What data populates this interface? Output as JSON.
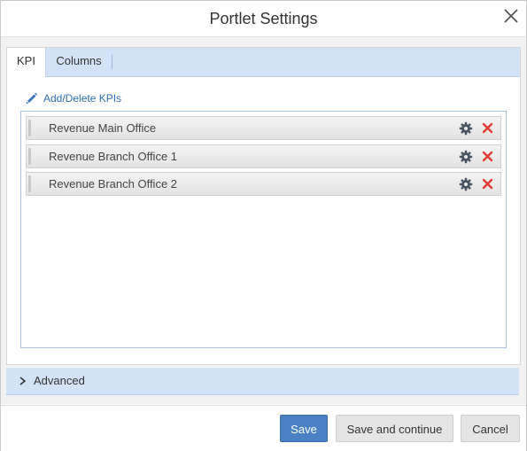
{
  "dialog": {
    "title": "Portlet Settings",
    "close_icon": "close-icon"
  },
  "tabs": [
    {
      "label": "KPI",
      "active": true
    },
    {
      "label": "Columns",
      "active": false
    }
  ],
  "kpi": {
    "add_link_label": "Add/Delete KPIs",
    "add_link_icon": "pencil-icon",
    "items": [
      {
        "label": "Revenue Main Office",
        "settings_icon": "gear-icon",
        "delete_icon": "delete-x-icon"
      },
      {
        "label": "Revenue Branch Office 1",
        "settings_icon": "gear-icon",
        "delete_icon": "delete-x-icon"
      },
      {
        "label": "Revenue Branch Office 2",
        "settings_icon": "gear-icon",
        "delete_icon": "delete-x-icon"
      }
    ]
  },
  "advanced": {
    "label": "Advanced",
    "icon": "chevron-right-icon",
    "expanded": false
  },
  "footer": {
    "save_label": "Save",
    "save_continue_label": "Save and continue",
    "cancel_label": "Cancel"
  },
  "colors": {
    "accent": "#4a80c4",
    "tab_bar": "#d2e3f8",
    "delete": "#e03a2f",
    "link": "#2f6eb5"
  }
}
